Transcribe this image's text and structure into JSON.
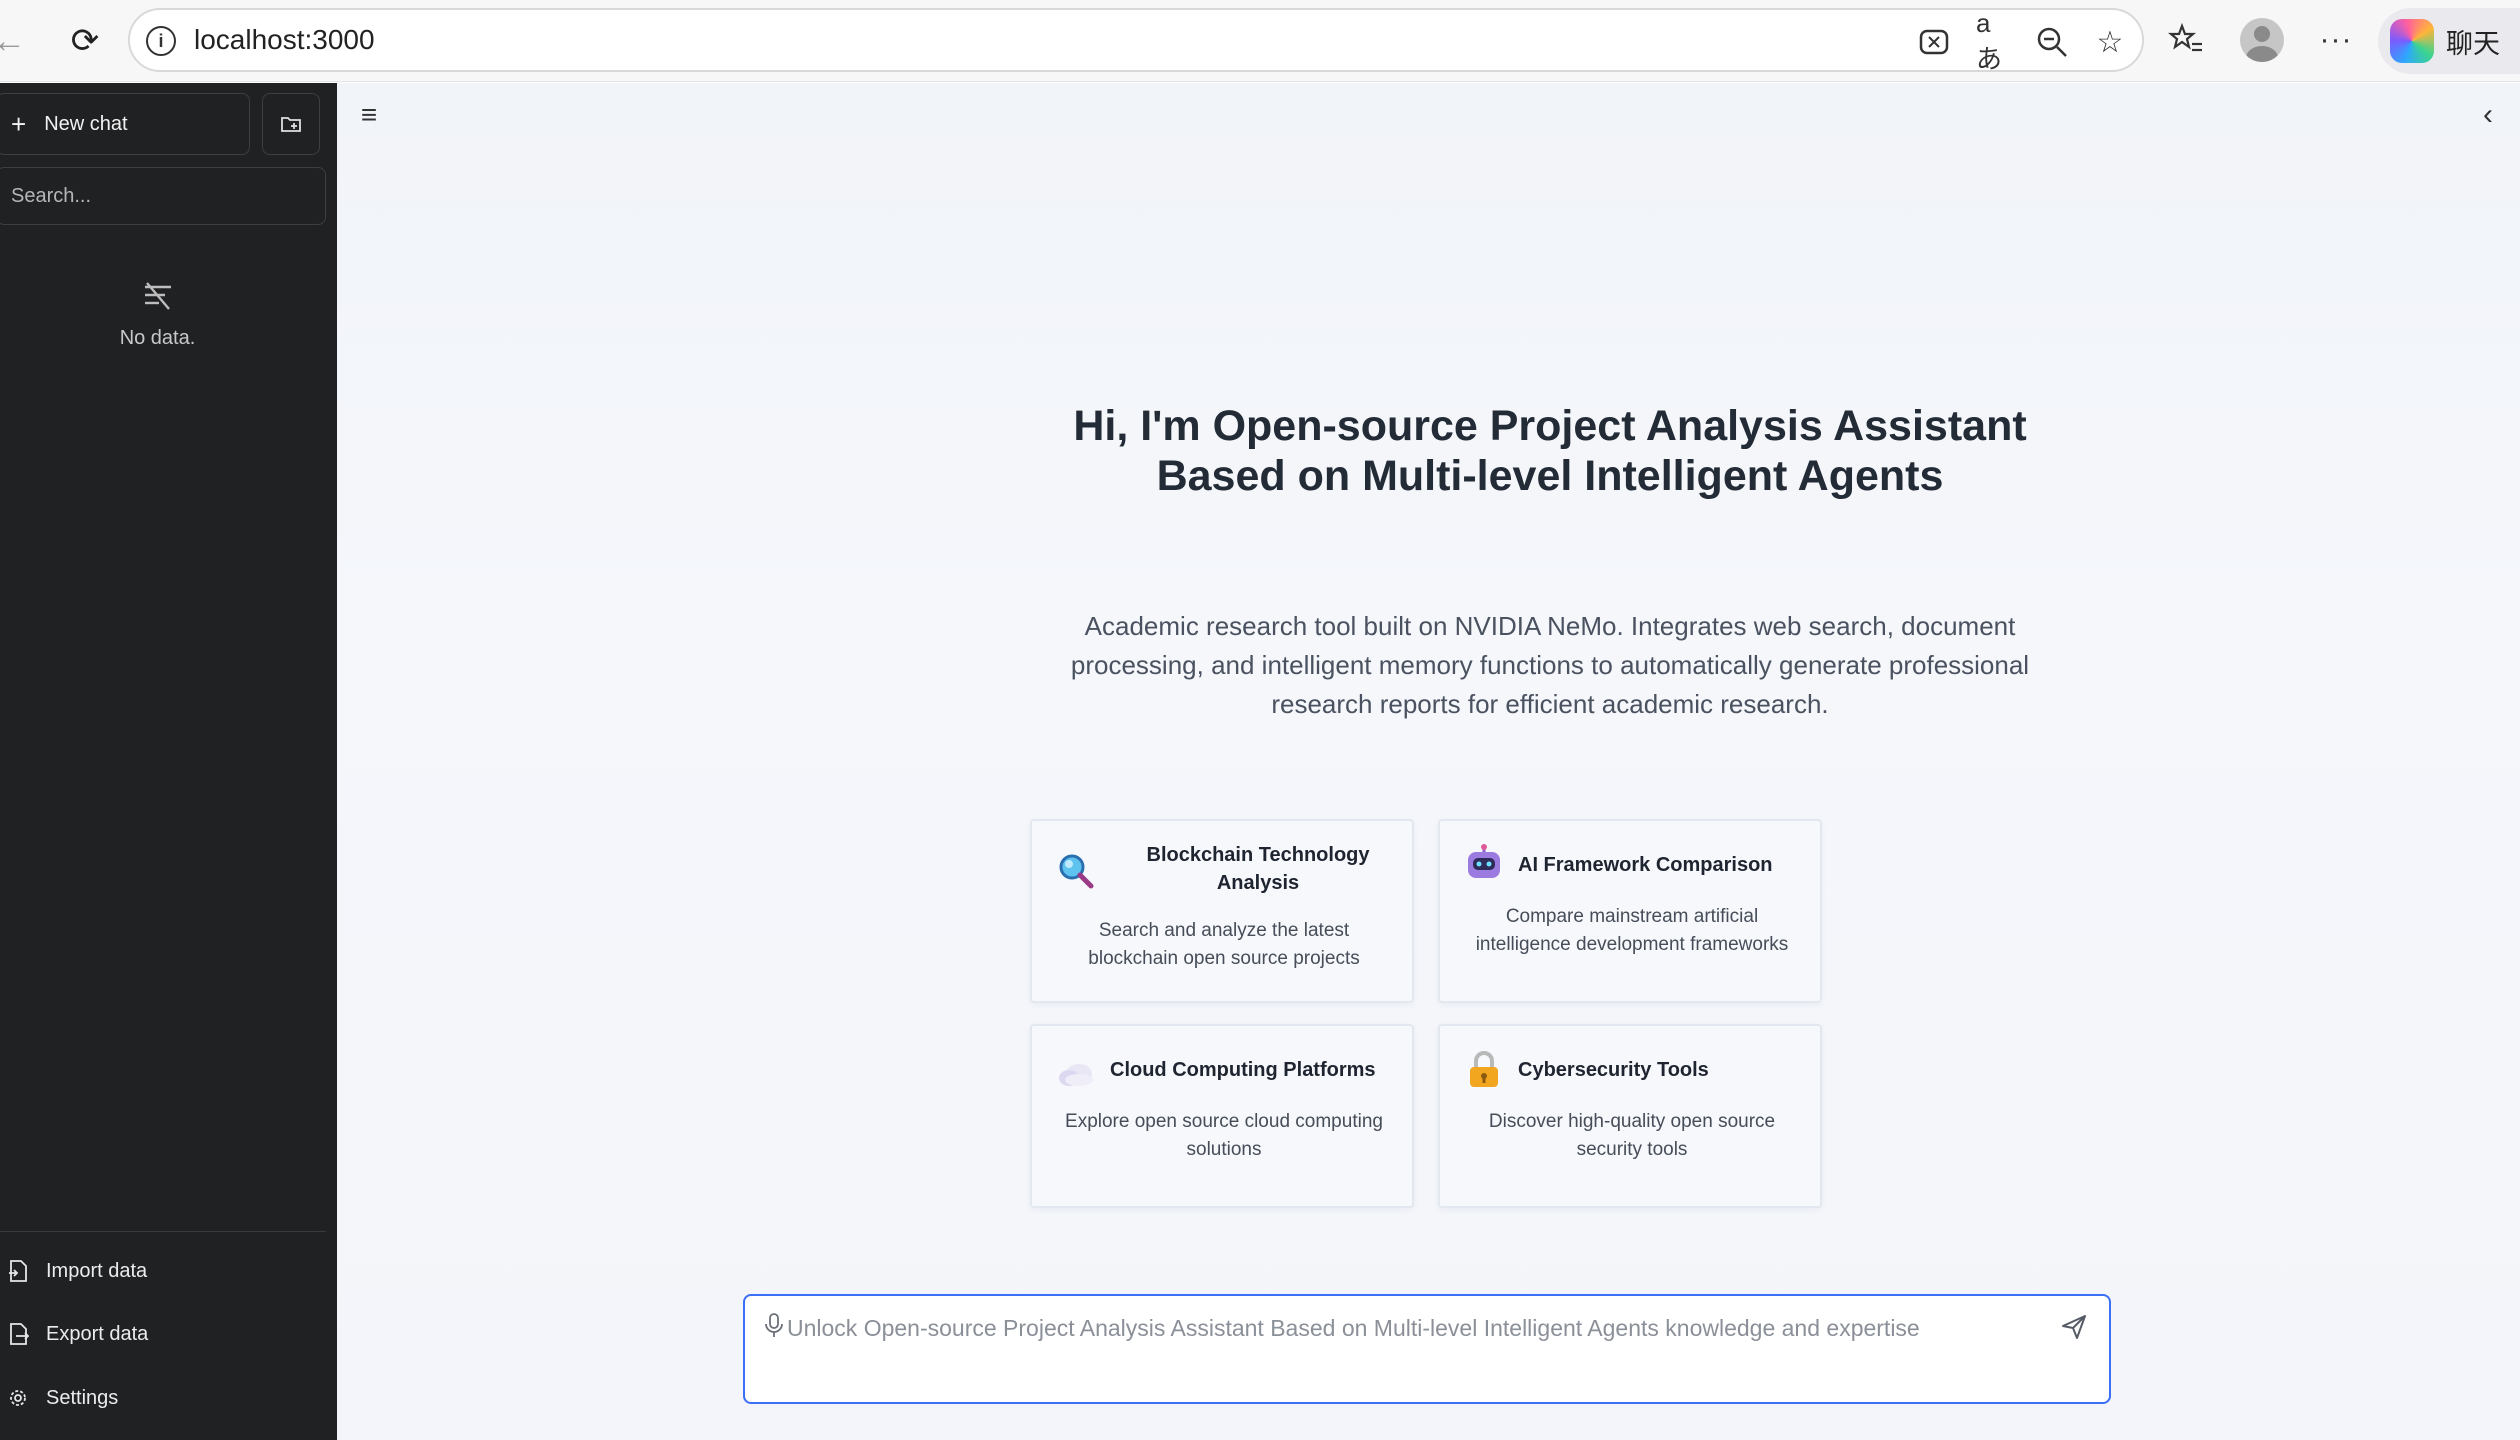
{
  "browser": {
    "url": "localhost:3000",
    "copilot_label": "聊天"
  },
  "sidebar": {
    "new_chat_label": "New chat",
    "search_placeholder": "Search...",
    "empty_text": "No data.",
    "actions": [
      {
        "label": "Import data",
        "icon": "import-file-icon"
      },
      {
        "label": "Export data",
        "icon": "export-file-icon"
      },
      {
        "label": "Settings",
        "icon": "gear-icon"
      }
    ]
  },
  "main": {
    "title": "Hi, I'm Open-source Project Analysis Assistant Based on Multi-level Intelligent Agents",
    "subtitle": "Academic research tool built on NVIDIA NeMo. Integrates web search, document processing, and intelligent memory functions to automatically generate professional research reports for efficient academic research.",
    "cards": [
      {
        "title": "Blockchain Technology Analysis",
        "description": "Search and analyze the latest blockchain open source projects",
        "icon": "magnifier-icon"
      },
      {
        "title": "AI Framework Comparison",
        "description": "Compare mainstream artificial intelligence development frameworks",
        "icon": "robot-icon"
      },
      {
        "title": "Cloud Computing Platforms",
        "description": "Explore open source cloud computing solutions",
        "icon": "cloud-icon"
      },
      {
        "title": "Cybersecurity Tools",
        "description": "Discover high-quality open source security tools",
        "icon": "lock-icon"
      }
    ],
    "input_placeholder": "Unlock Open-source Project Analysis Assistant Based on Multi-level Intelligent Agents knowledge and expertise"
  },
  "colors": {
    "sidebar_bg": "#202123",
    "accent": "#3b6ff5",
    "main_bg": "#f3f5fa"
  }
}
